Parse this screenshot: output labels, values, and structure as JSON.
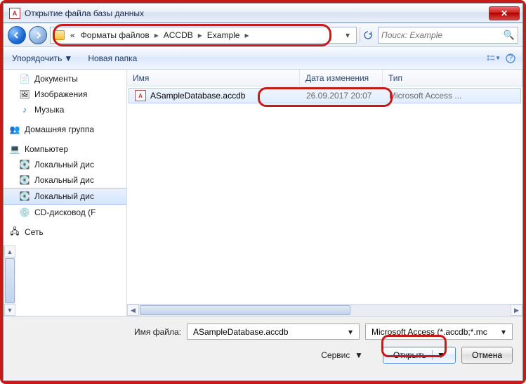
{
  "window": {
    "title": "Открытие файла базы данных"
  },
  "nav": {
    "crumb_prefix": "«",
    "crumb1": "Форматы файлов",
    "crumb2": "ACCDB",
    "crumb3": "Example",
    "search_placeholder": "Поиск: Example"
  },
  "toolbar": {
    "organize": "Упорядочить",
    "newfolder": "Новая папка"
  },
  "sidebar": {
    "docs": "Документы",
    "images": "Изображения",
    "music": "Музыка",
    "homegroup": "Домашняя группа",
    "computer": "Компьютер",
    "disk1": "Локальный дис",
    "disk2": "Локальный дис",
    "disk3": "Локальный дис",
    "cd": "CD-дисковод (F",
    "network": "Сеть"
  },
  "columns": {
    "name": "Имя",
    "date": "Дата изменения",
    "type": "Тип"
  },
  "file": {
    "name": "ASampleDatabase.accdb",
    "date": "26.09.2017 20:07",
    "type": "Microsoft Access ..."
  },
  "bottom": {
    "fname_label": "Имя файла:",
    "fname_value": "ASampleDatabase.accdb",
    "ftype_value": "Microsoft Access (*.accdb;*.mc",
    "service": "Сервис",
    "open": "Открыть",
    "cancel": "Отмена"
  }
}
